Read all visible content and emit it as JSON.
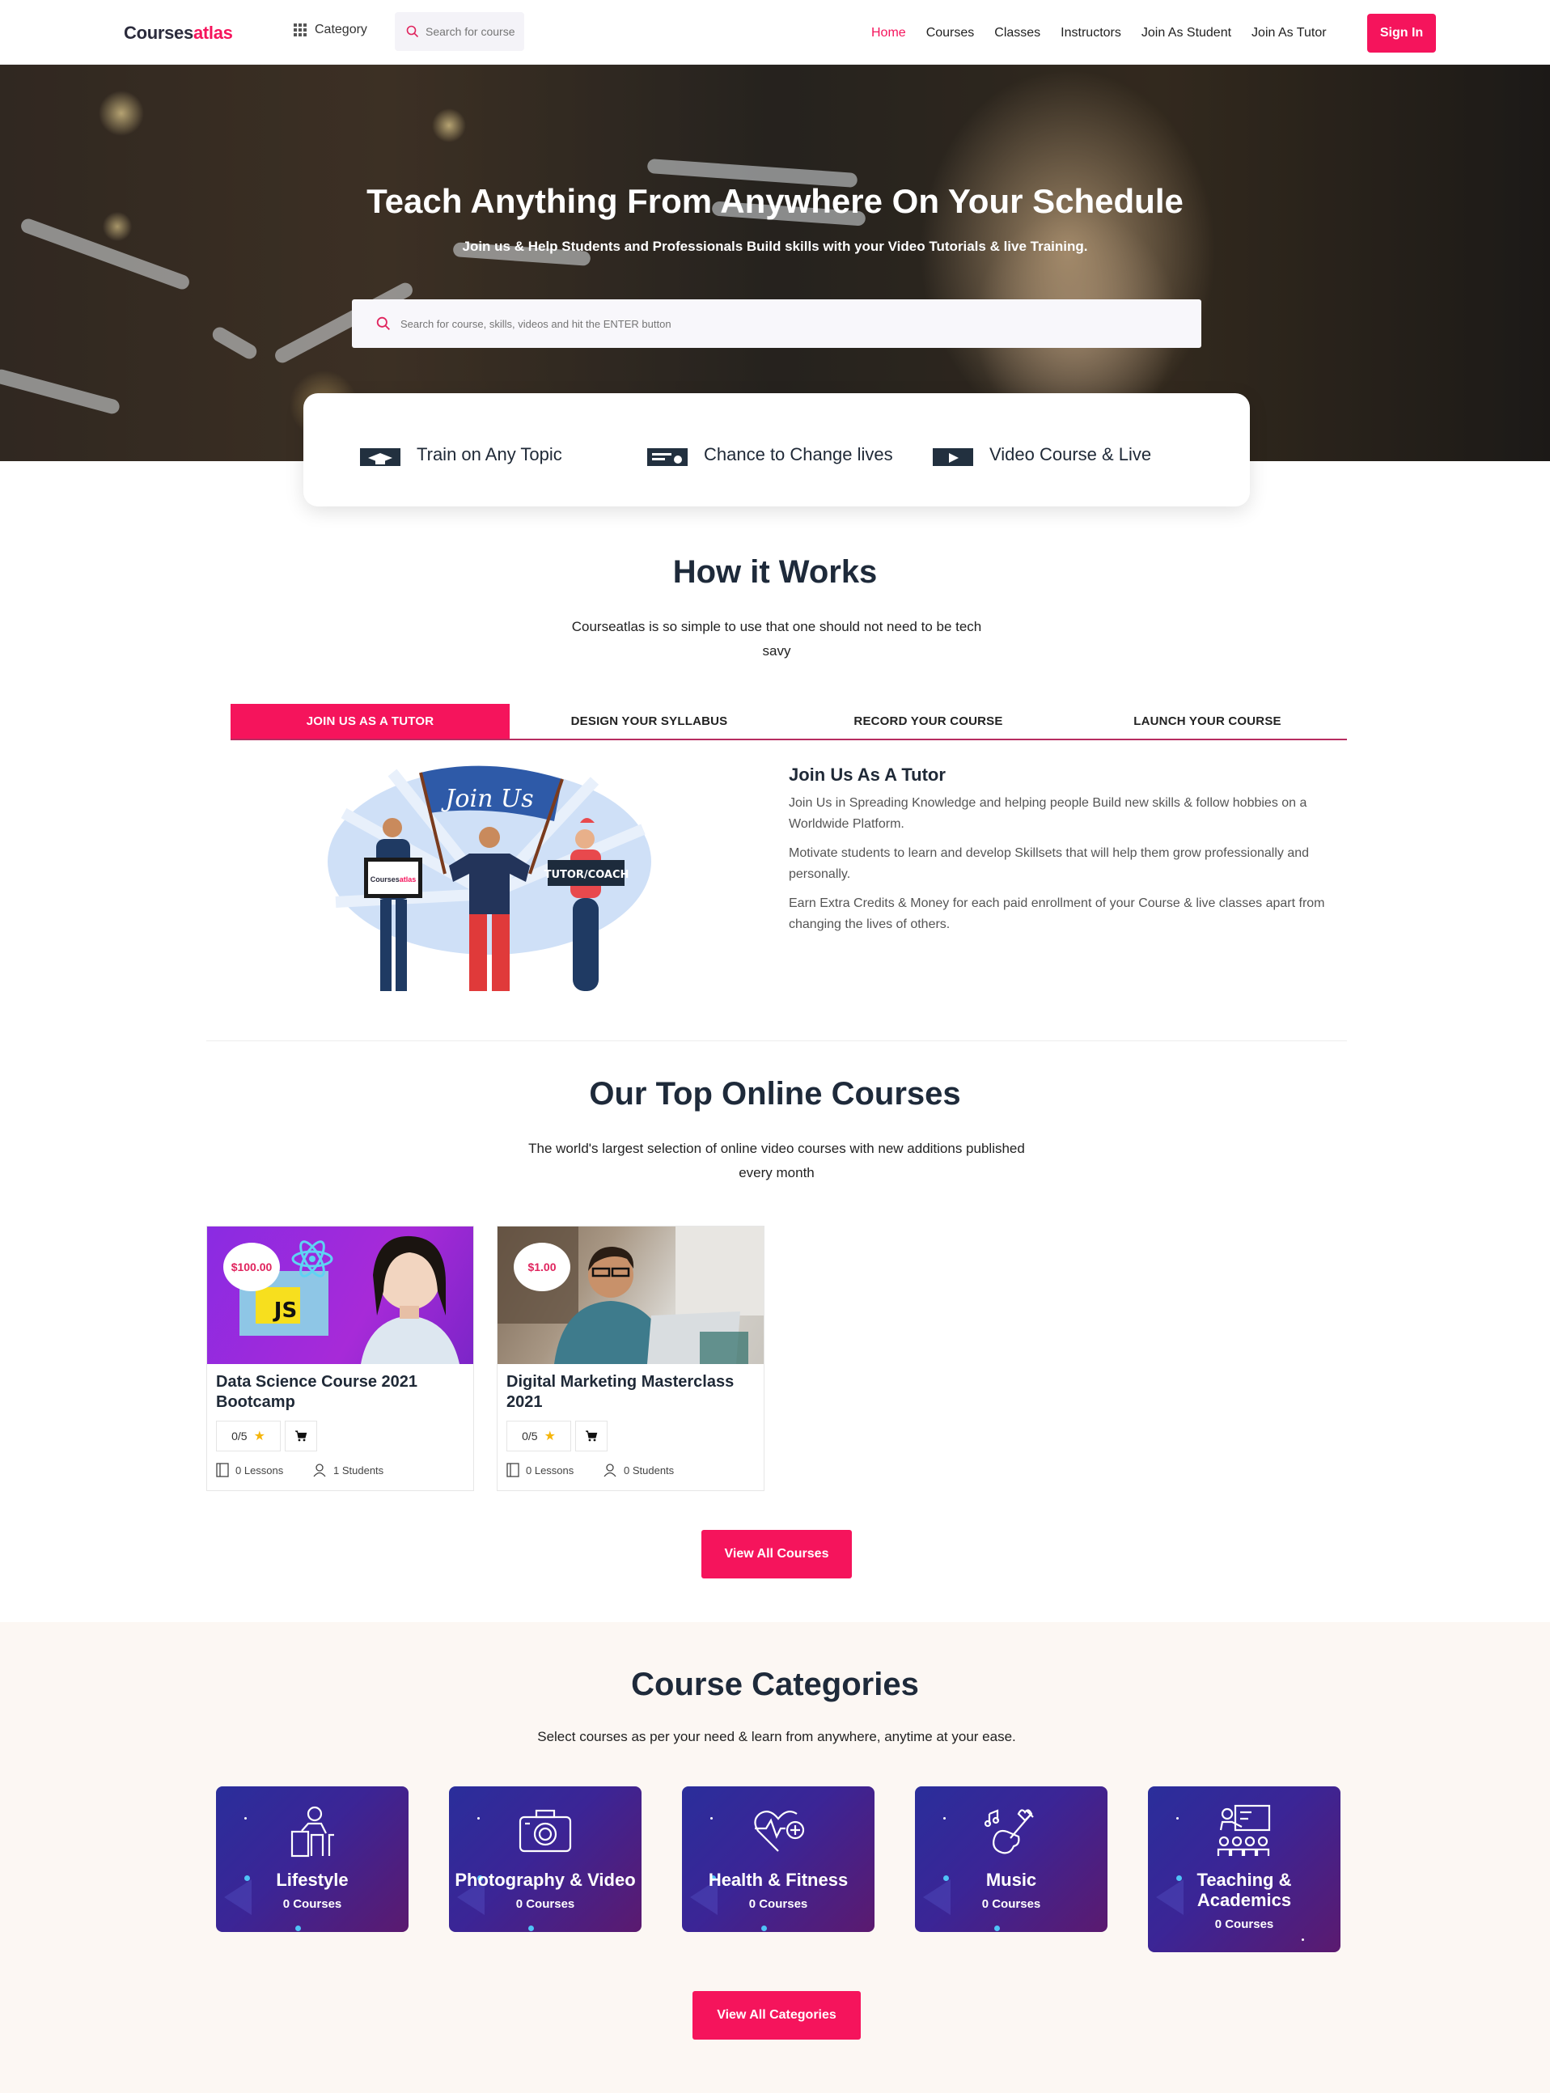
{
  "nav": {
    "logo_main": "Courses",
    "logo_accent": "atlas",
    "category_label": "Category",
    "search_placeholder": "Search for course, skills, videos and hit the ENTER button",
    "links": [
      "Home",
      "Courses",
      "Classes",
      "Instructors",
      "Join As Student",
      "Join As Tutor"
    ],
    "active_link": "Home",
    "signin_label": "Sign In"
  },
  "hero": {
    "title": "Teach Anything From Anywhere On Your Schedule",
    "subtitle": "Join us & Help Students and Professionals Build skills with your Video Tutorials & live Training.",
    "search_placeholder": "Search for course, skills, videos and hit the ENTER button"
  },
  "features": [
    {
      "icon": "graduation-cap-icon",
      "label": "Train on Any Topic"
    },
    {
      "icon": "certificate-icon",
      "label": "Chance to Change lives"
    },
    {
      "icon": "video-play-icon",
      "label": "Video Course & Live"
    }
  ],
  "how": {
    "title": "How it Works",
    "subtitle_line1": "Courseatlas is so simple to use that one should not need to be tech",
    "subtitle_line2": "savy",
    "tabs": [
      "JOIN US AS A TUTOR",
      "DESIGN YOUR SYLLABUS",
      "RECORD YOUR COURSE",
      "LAUNCH YOUR COURSE"
    ],
    "active_tab": 0,
    "illustration": {
      "banner_text": "Join Us",
      "laptop_text_main": "Courses",
      "laptop_text_accent": "atlas",
      "sign_text": "TUTOR/COACH"
    },
    "content_title": "Join Us As A Tutor",
    "paragraphs": [
      "Join Us in Spreading Knowledge and helping people Build new skills & follow hobbies on a Worldwide Platform.",
      "Motivate students to learn and develop Skillsets that will help them grow professionally and personally.",
      "Earn Extra Credits & Money for each paid enrollment of your Course & live classes apart from changing the lives of others."
    ]
  },
  "courses": {
    "title": "Our Top Online Courses",
    "subtitle_line1": "The world's largest selection of online video courses with new additions published",
    "subtitle_line2": "every month",
    "items": [
      {
        "price": "$100.00",
        "title": "Data Science Course 2021 Bootcamp",
        "rating": "0/5",
        "lessons": "0 Lessons",
        "students": "1 Students",
        "thumb_badge": "JS"
      },
      {
        "price": "$1.00",
        "title": "Digital Marketing Masterclass 2021",
        "rating": "0/5",
        "lessons": "0 Lessons",
        "students": "0 Students"
      }
    ],
    "view_all_label": "View All Courses"
  },
  "categories": {
    "title": "Course Categories",
    "subtitle": "Select courses as per your need & learn from anywhere, anytime at your ease.",
    "items": [
      {
        "name": "Lifestyle",
        "count": "0 Courses",
        "icon": "lifestyle-icon"
      },
      {
        "name": "Photography & Video",
        "count": "0 Courses",
        "icon": "camera-icon"
      },
      {
        "name": "Health & Fitness",
        "count": "0 Courses",
        "icon": "heart-pulse-icon"
      },
      {
        "name": "Music",
        "count": "0 Courses",
        "icon": "guitar-icon"
      },
      {
        "name_line1": "Teaching &",
        "name_line2": "Academics",
        "count": "0 Courses",
        "icon": "teacher-board-icon"
      }
    ],
    "view_all_label": "View All Categories"
  },
  "colors": {
    "accent": "#f5145c",
    "heading": "#1e2a3a",
    "category_bg": "#fcf7f3"
  }
}
